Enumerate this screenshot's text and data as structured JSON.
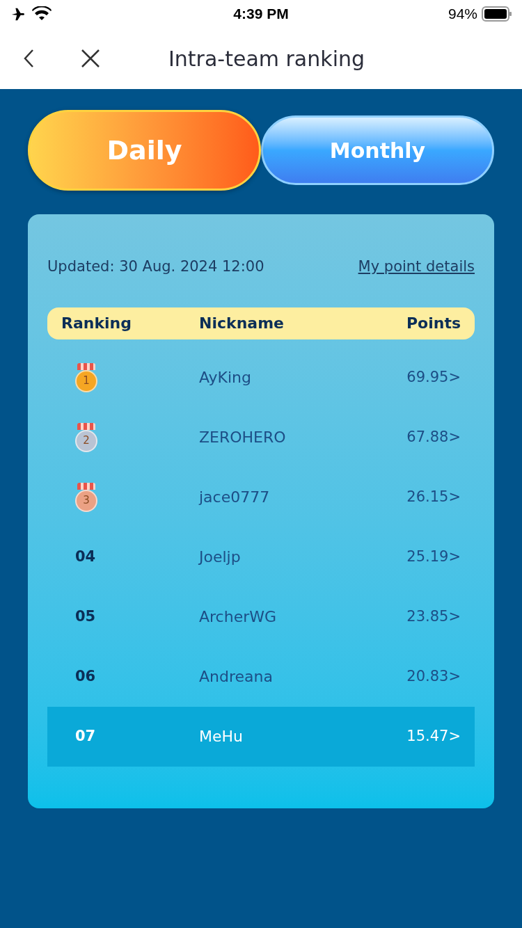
{
  "status_bar": {
    "time": "4:39 PM",
    "battery_text": "94%"
  },
  "nav": {
    "title": "Intra-team ranking"
  },
  "tabs": [
    {
      "label": "Daily",
      "selected": true
    },
    {
      "label": "Monthly",
      "selected": false
    }
  ],
  "updated": "Updated: 30 Aug. 2024 12:00",
  "details_link": "My point details",
  "table": {
    "columns": [
      "Ranking",
      "Nickname",
      "Points"
    ],
    "rows": [
      {
        "kind": "medal",
        "rank": "1",
        "color": "#f5a623",
        "nickname": "AyKing",
        "points": "69.95>",
        "highlighted": false
      },
      {
        "kind": "medal",
        "rank": "2",
        "color": "#b9c3d3",
        "nickname": "ZEROHERO",
        "points": "67.88>",
        "highlighted": false
      },
      {
        "kind": "medal",
        "rank": "3",
        "color": "#eba184",
        "nickname": "jace0777",
        "points": "26.15>",
        "highlighted": false
      },
      {
        "kind": "number",
        "rank": "04",
        "nickname": "Joeljp",
        "points": "25.19>",
        "highlighted": false
      },
      {
        "kind": "number",
        "rank": "05",
        "nickname": "ArcherWG",
        "points": "23.85>",
        "highlighted": false
      },
      {
        "kind": "number",
        "rank": "06",
        "nickname": "Andreana",
        "points": "20.83>",
        "highlighted": false
      },
      {
        "kind": "number",
        "rank": "07",
        "nickname": "MeHu",
        "points": "15.47>",
        "highlighted": true
      }
    ]
  }
}
